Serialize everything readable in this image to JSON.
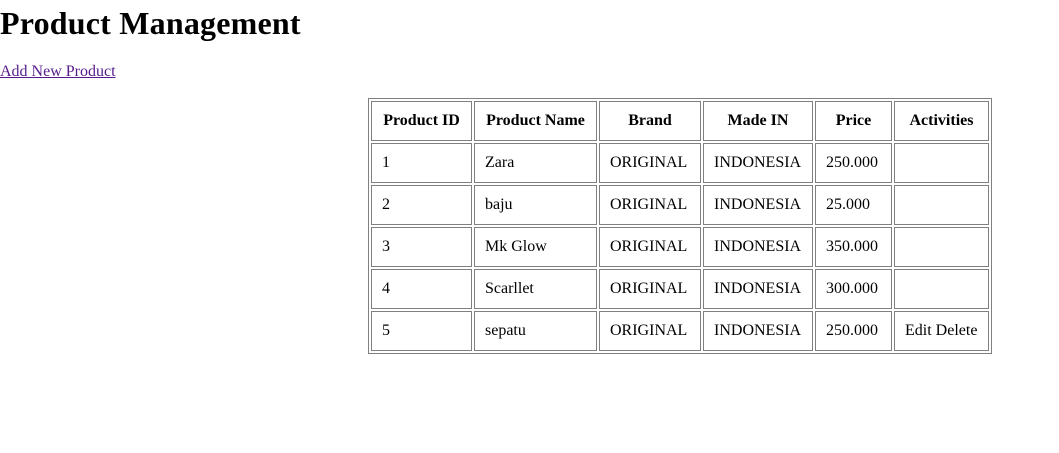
{
  "page": {
    "title": "Product Management",
    "add_link": "Add New Product"
  },
  "table": {
    "headers": [
      "Product ID",
      "Product Name",
      "Brand",
      "Made IN",
      "Price",
      "Activities"
    ],
    "rows": [
      {
        "id": "1",
        "name": "Zara",
        "brand": "ORIGINAL",
        "made_in": "INDONESIA",
        "price": "250.000",
        "activities": ""
      },
      {
        "id": "2",
        "name": "baju",
        "brand": "ORIGINAL",
        "made_in": "INDONESIA",
        "price": "25.000",
        "activities": ""
      },
      {
        "id": "3",
        "name": "Mk Glow",
        "brand": "ORIGINAL",
        "made_in": "INDONESIA",
        "price": "350.000",
        "activities": ""
      },
      {
        "id": "4",
        "name": "Scarllet",
        "brand": "ORIGINAL",
        "made_in": "INDONESIA",
        "price": "300.000",
        "activities": ""
      },
      {
        "id": "5",
        "name": "sepatu",
        "brand": "ORIGINAL",
        "made_in": "INDONESIA",
        "price": "250.000",
        "activities": "Edit Delete"
      }
    ]
  }
}
